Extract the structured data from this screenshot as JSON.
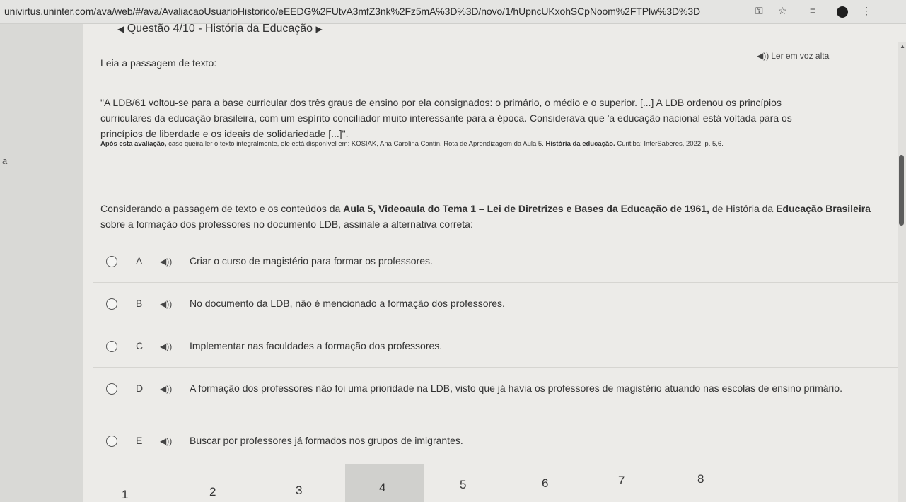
{
  "browser": {
    "url": "univirtus.uninter.com/ava/web/#/ava/AvaliacaoUsuarioHistorico/eEEDG%2FUtvA3mfZ3nk%2Fz5mA%3D%3D/novo/1/hUpncUKxohSCpNoom%2FTPlw%3D%3D"
  },
  "header": {
    "title": "Questão 4/10 - História da Educação"
  },
  "left_marker": "a",
  "passage": {
    "lead": "Leia a passagem de texto:",
    "tts_label": "Ler em voz alta",
    "quote_lines": [
      "\"A LDB/61 voltou-se para a base curricular dos três graus de ensino por ela consignados: o primário, o médio e o superior. [...] A LDB ordenou os princípios",
      "curriculares da educação brasileira, com um espírito conciliador muito interessante para a época. Considerava que 'a educação nacional está voltada para os",
      "princípios de liberdade e os ideais de solidariedade [...]\"."
    ],
    "source_bold_intro": "Após esta avaliação,",
    "source_text": " caso queira ler o texto integralmente, ele está disponível em: KOSIAK, Ana Carolina Contin. Rota de Aprendizagem da Aula 5. ",
    "source_bold_title": "História da educação.",
    "source_tail": " Curitiba: InterSaberes, 2022. p. 5,6."
  },
  "question": {
    "prefix": "Considerando a passagem de texto e os conteúdos da ",
    "bold1": "Aula 5, Videoaula do Tema 1 – Lei de Diretrizes e Bases da Educação de 1961,",
    "middle": " de História da ",
    "bold2": "Educação Brasileira",
    "suffix": " sobre a formação dos professores no documento LDB, assinale a alternativa correta:"
  },
  "options": [
    {
      "letter": "A",
      "text": "Criar o curso de magistério para formar os professores."
    },
    {
      "letter": "B",
      "text": "No documento da LDB, não é mencionado a formação dos professores."
    },
    {
      "letter": "C",
      "text": "Implementar nas faculdades a formação dos professores."
    },
    {
      "letter": "D",
      "text": "A formação dos professores não foi uma prioridade na LDB, visto que já havia os professores de magistério atuando nas escolas de ensino primário."
    },
    {
      "letter": "E",
      "text": "Buscar por professores já formados nos grupos de imigrantes."
    }
  ],
  "pagination": {
    "pages": [
      "1",
      "2",
      "3",
      "4",
      "5",
      "6",
      "7",
      "8"
    ],
    "active_page": "4"
  },
  "icons": {
    "speaker": "speaker-icon",
    "star": "star-icon",
    "key": "key-icon",
    "menu": "kebab-menu-icon"
  }
}
